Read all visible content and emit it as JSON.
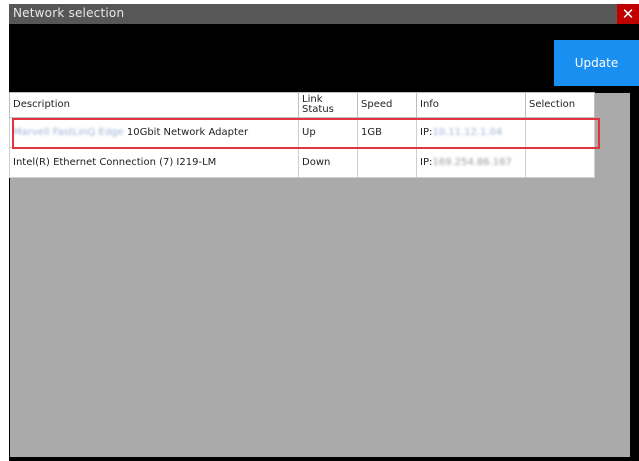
{
  "window": {
    "title": "Network selection",
    "close_glyph": "✕"
  },
  "toolbar": {
    "update_label": "Update"
  },
  "table": {
    "headers": {
      "description": "Description",
      "link_status": "Link Status",
      "speed": "Speed",
      "info": "Info",
      "selection": "Selection"
    },
    "rows": [
      {
        "description_redacted": "Marvell FastLinQ Edge",
        "description": " 10Gbit Network Adapter",
        "link_status": "Up",
        "speed": "1GB",
        "info_prefix": "IP:",
        "info_redacted": "10.11.12.1.04",
        "selection": ""
      },
      {
        "description": "Intel(R) Ethernet Connection (7) I219-LM",
        "link_status": "Down",
        "speed": "",
        "info_prefix": "IP:",
        "info_redacted": "169.254.86.167",
        "selection": ""
      }
    ]
  },
  "colors": {
    "title_bar": "#575757",
    "close_button": "#c00000",
    "update_button": "#1a8ff2",
    "content_bg": "#aaaaaa",
    "highlight": "#e0343f"
  }
}
